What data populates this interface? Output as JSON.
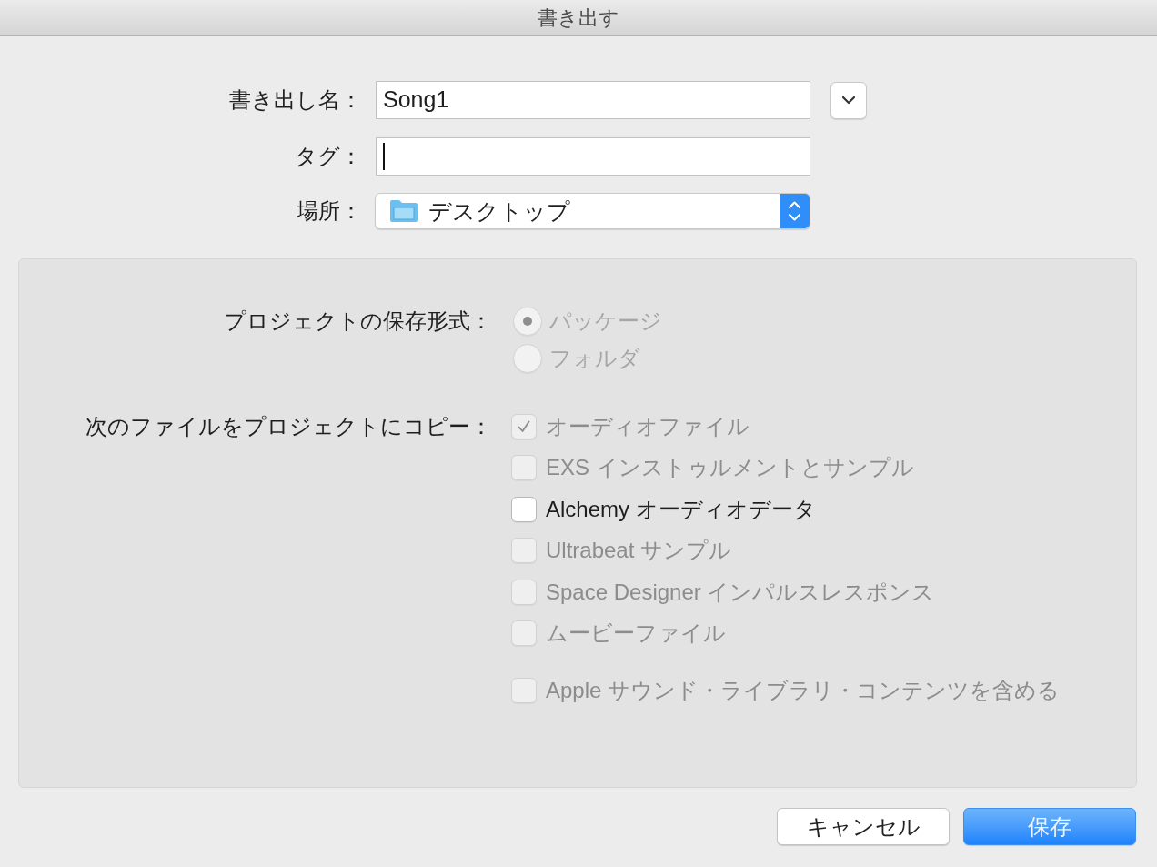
{
  "window": {
    "title": "書き出す"
  },
  "form": {
    "export_name": {
      "label": "書き出し名：",
      "value": "Song1",
      "expanded": false
    },
    "tags": {
      "label": "タグ：",
      "focused": true
    },
    "location": {
      "label": "場所：",
      "value": "デスクトップ"
    }
  },
  "options": {
    "format": {
      "label": "プロジェクトの保存形式：",
      "choices": [
        {
          "label": "パッケージ",
          "selected": true,
          "disabled": true
        },
        {
          "label": "フォルダ",
          "selected": false,
          "disabled": true
        }
      ]
    },
    "copy": {
      "label": "次のファイルをプロジェクトにコピー：",
      "items": [
        {
          "label": "オーディオファイル",
          "checked": true,
          "disabled": true
        },
        {
          "label": "EXS インストゥルメントとサンプル",
          "checked": false,
          "disabled": true
        },
        {
          "label": "Alchemy オーディオデータ",
          "checked": false,
          "disabled": false
        },
        {
          "label": "Ultrabeat サンプル",
          "checked": false,
          "disabled": true
        },
        {
          "label": "Space Designer インパルスレスポンス",
          "checked": false,
          "disabled": true
        },
        {
          "label": "ムービーファイル",
          "checked": false,
          "disabled": true
        }
      ]
    },
    "include_library": {
      "label": "Apple サウンド・ライブラリ・コンテンツを含める",
      "checked": false,
      "disabled": true
    }
  },
  "buttons": [
    {
      "label": "キャンセル",
      "kind": "default"
    },
    {
      "label": "保存",
      "kind": "primary"
    }
  ]
}
